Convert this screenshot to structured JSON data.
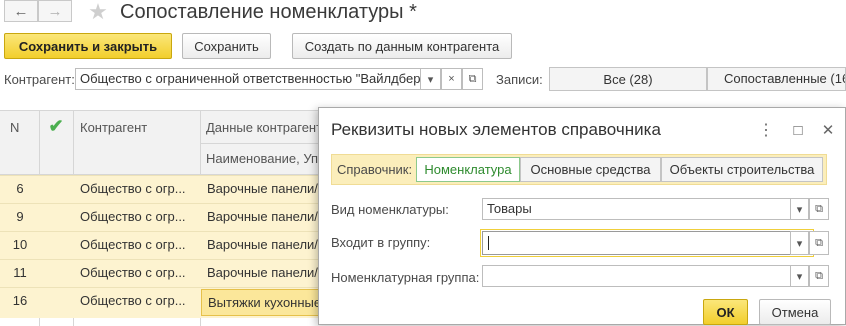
{
  "window": {
    "title": "Сопоставление номенклатуры *",
    "back_icon": "←",
    "forward_icon": "→",
    "star_icon": "★"
  },
  "toolbar": {
    "save_close_label": "Сохранить и закрыть",
    "save_label": "Сохранить",
    "create_label": "Создать по данным контрагента"
  },
  "filter": {
    "label": "Контрагент:",
    "value": "Общество с ограниченной ответственностью \"Вайлдбер",
    "records_label": "Записи:",
    "segments": [
      "Все (28)",
      "Сопоставленные (16"
    ]
  },
  "table": {
    "headers": {
      "n": "N",
      "contractor": "Контрагент",
      "data": "Данные контрагент",
      "data_sub": "Наименование, Уп"
    },
    "rows": [
      {
        "n": "6",
        "contractor": "Общество с огр...",
        "data": "Варочные панели/"
      },
      {
        "n": "9",
        "contractor": "Общество с огр...",
        "data": "Варочные панели/"
      },
      {
        "n": "10",
        "contractor": "Общество с огр...",
        "data": "Варочные панели/"
      },
      {
        "n": "11",
        "contractor": "Общество с огр...",
        "data": "Варочные панели/"
      },
      {
        "n": "16",
        "contractor": "Общество с огр...",
        "data": "Вытяжки кухонные"
      }
    ]
  },
  "dialog": {
    "title": "Реквизиты новых элементов справочника",
    "more_icon": "⋮",
    "maximize_icon": "□",
    "close_icon": "✕",
    "ref_label": "Справочник:",
    "ref_tabs": [
      "Номенклатура",
      "Основные средства",
      "Объекты строительства"
    ],
    "kind_label": "Вид номенклатуры:",
    "kind_value": "Товары",
    "group_label": "Входит в группу:",
    "group_value": "",
    "nomgroup_label": "Номенклатурная группа:",
    "nomgroup_value": "",
    "ok_label": "ОК",
    "cancel_label": "Отмена"
  },
  "colors": {
    "accent_yellow": "#f2cf2c",
    "row_highlight": "#fdf3d0",
    "check_green": "#4caf50",
    "active_tab_text": "#2e8b2e"
  }
}
